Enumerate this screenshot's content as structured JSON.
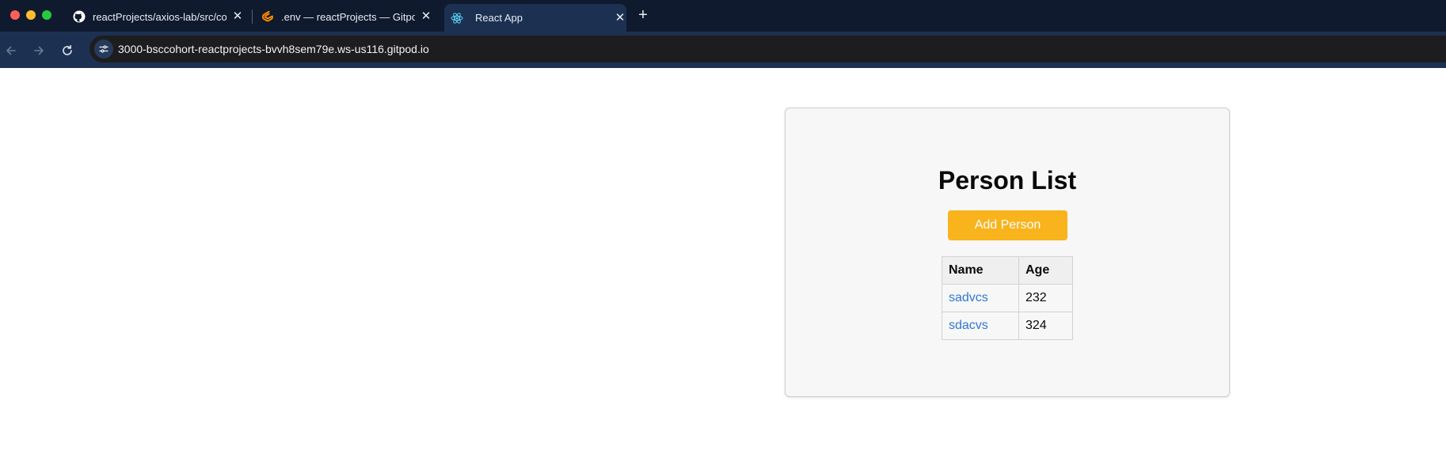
{
  "browser": {
    "tabs": [
      {
        "title": "reactProjects/axios-lab/src/co",
        "icon": "github-icon",
        "active": false
      },
      {
        "title": ".env — reactProjects — Gitpod",
        "icon": "gitpod-icon",
        "active": false
      },
      {
        "title": "React App",
        "icon": "react-icon",
        "active": true
      }
    ],
    "close_glyph": "✕",
    "new_tab_glyph": "+",
    "url": "3000-bsccohort-reactprojects-bvvh8sem79e.ws-us116.gitpod.io"
  },
  "page": {
    "title": "Person List",
    "add_button_label": "Add Person",
    "table": {
      "headers": [
        "Name",
        "Age"
      ],
      "rows": [
        {
          "name": "sadvcs",
          "age": "232"
        },
        {
          "name": "sdacvs",
          "age": "324"
        }
      ]
    }
  },
  "colors": {
    "tabbar_bg": "#0f1a2e",
    "toolbar_bg": "#1c3152",
    "accent_button": "#f9b31c",
    "link": "#2f78d4",
    "card_bg": "#f7f7f7"
  }
}
